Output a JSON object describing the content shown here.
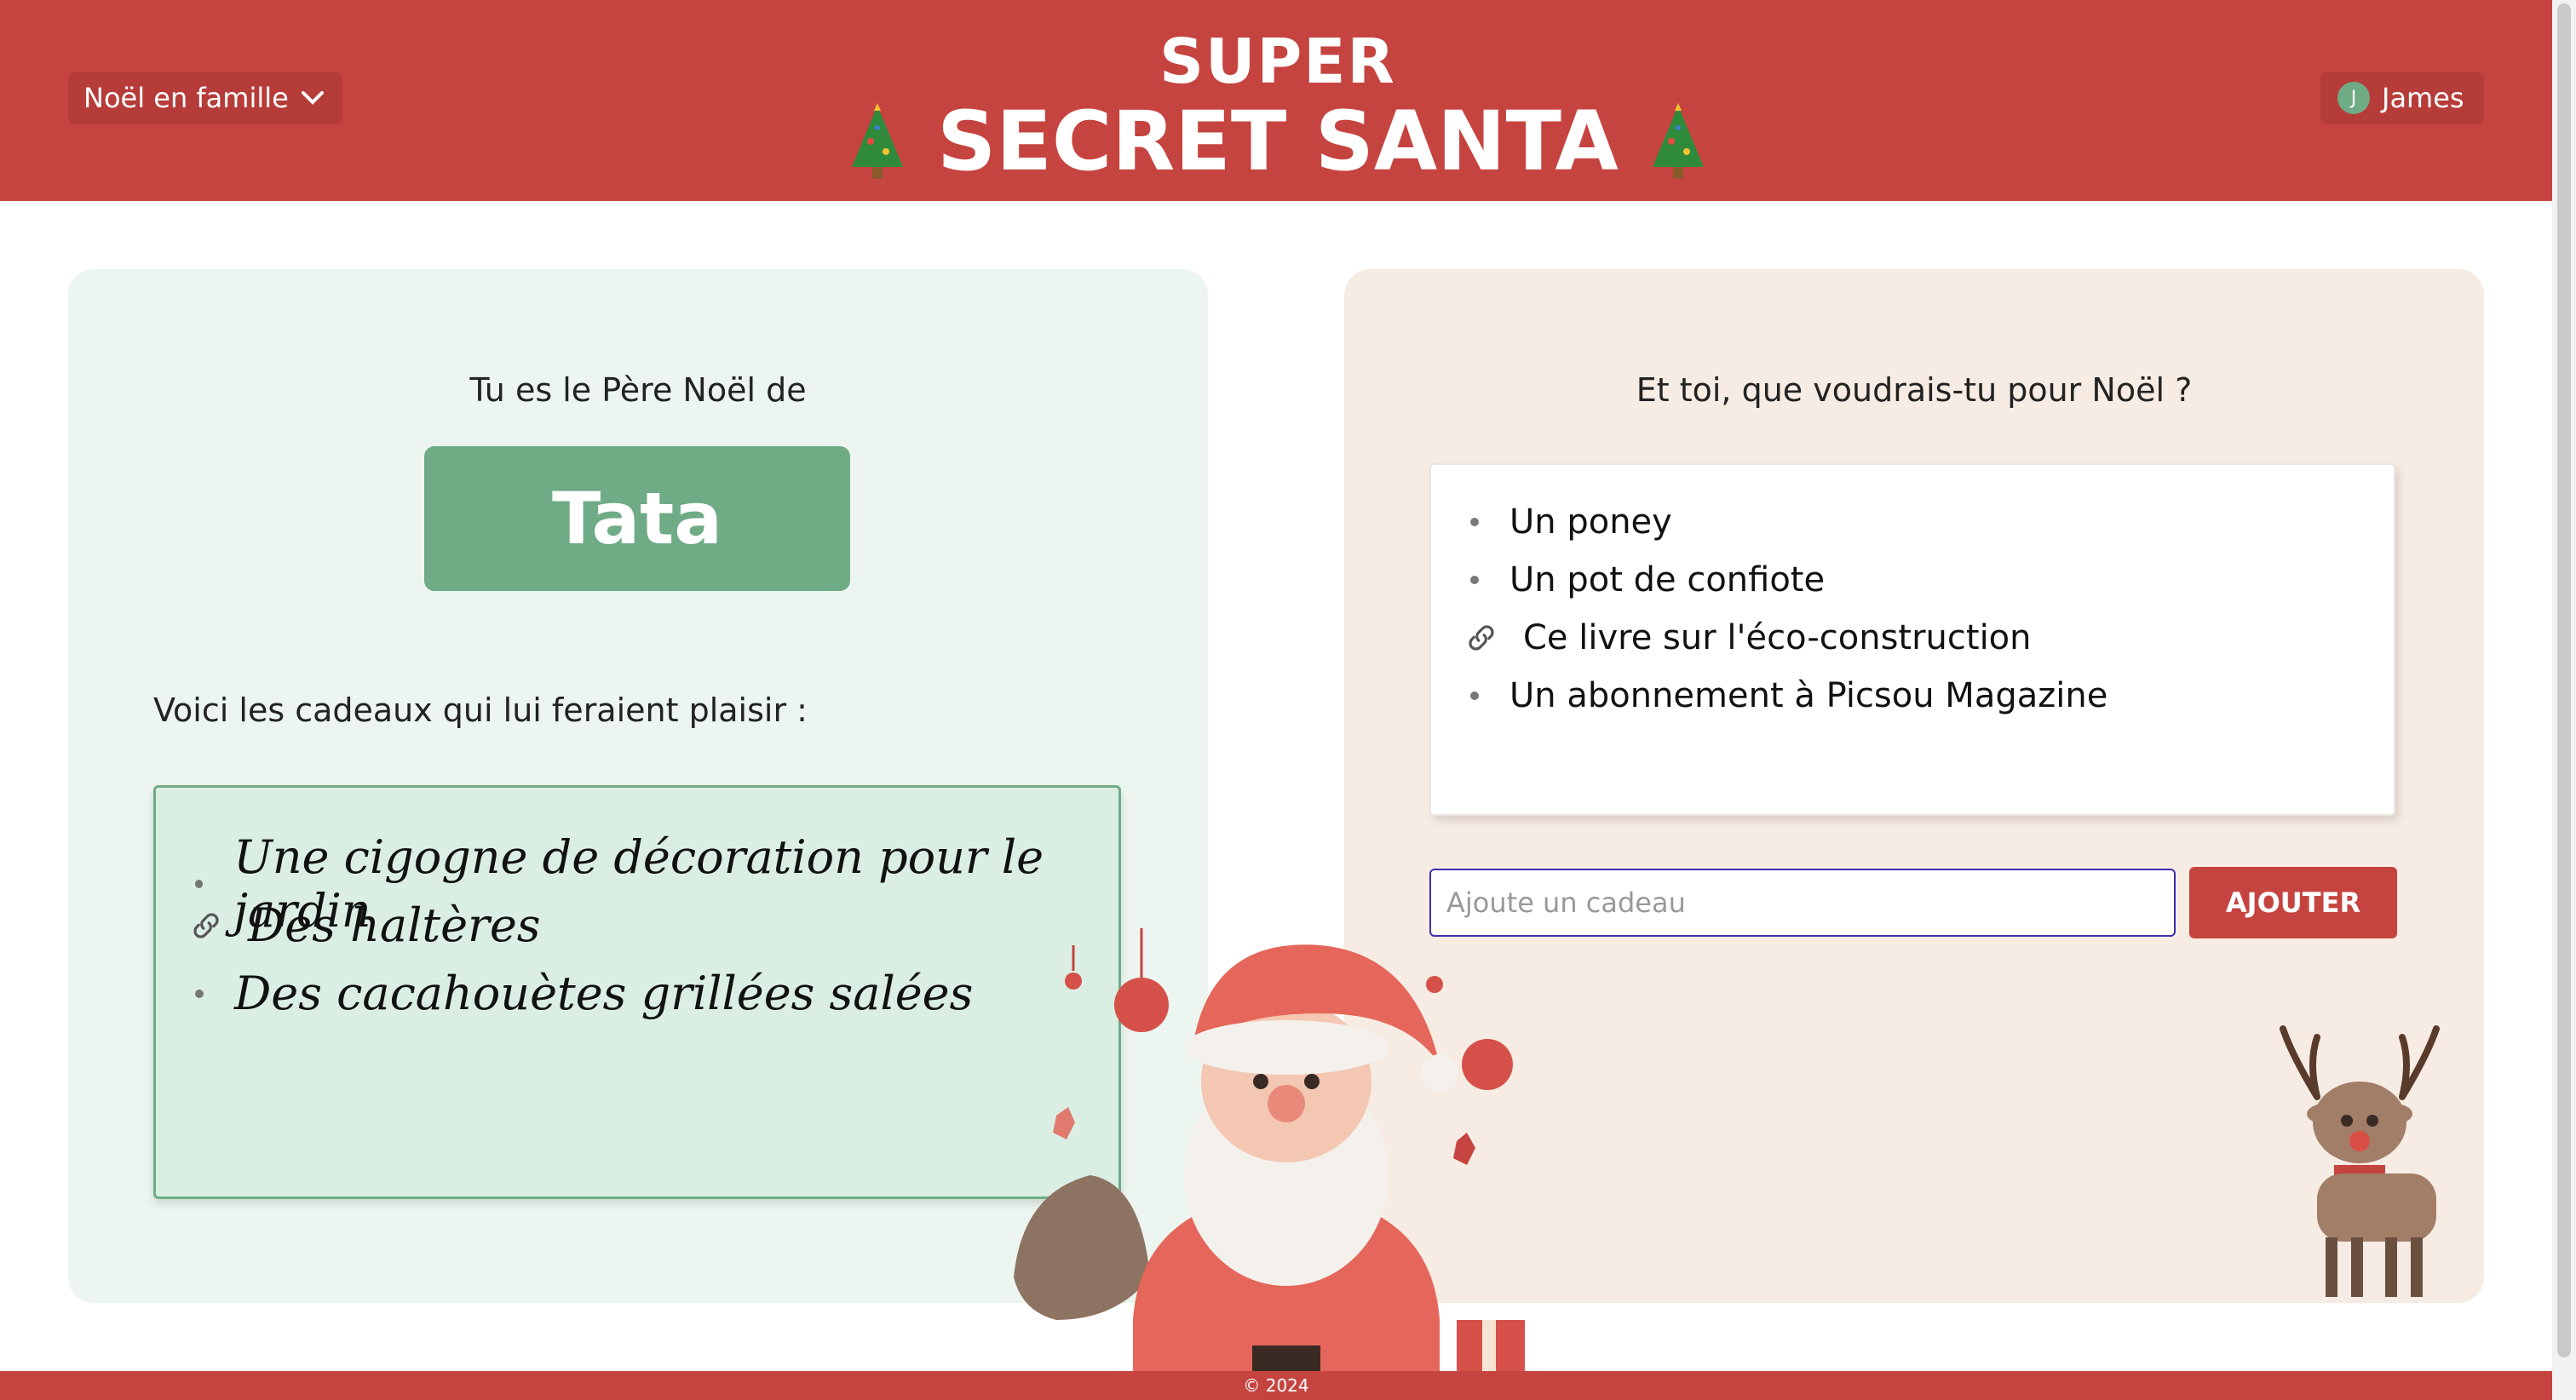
{
  "header": {
    "group_selector": "Noël en famille",
    "title_top": "SUPER",
    "title_main": "SECRET SANTA",
    "user_initial": "J",
    "user_name": "James"
  },
  "left_panel": {
    "heading": "Tu es le Père Noël de",
    "recipient_name": "Tata",
    "gifts_intro": "Voici les cadeaux qui lui feraient plaisir :",
    "gifts": [
      {
        "text": "Une cigogne de décoration pour le jardin",
        "icon": "bullet"
      },
      {
        "text": "Des haltères",
        "icon": "link-icon"
      },
      {
        "text": "Des cacahouètes grillées salées",
        "icon": "bullet"
      }
    ]
  },
  "right_panel": {
    "heading": "Et toi, que voudrais-tu pour Noël ?",
    "wishes": [
      {
        "text": "Un poney",
        "icon": "bullet"
      },
      {
        "text": "Un pot de confiote",
        "icon": "bullet"
      },
      {
        "text": "Ce livre sur l'éco-construction",
        "icon": "link-icon"
      },
      {
        "text": "Un abonnement à Picsou Magazine",
        "icon": "bullet"
      }
    ],
    "input_placeholder": "Ajoute un cadeau",
    "add_button": "AJOUTER"
  },
  "footer": {
    "text": "© 2024"
  },
  "colors": {
    "brand_red": "#c64440",
    "accent_green": "#6fac86",
    "left_panel_bg": "#ecf5ef",
    "right_panel_bg": "#f7ece3"
  }
}
